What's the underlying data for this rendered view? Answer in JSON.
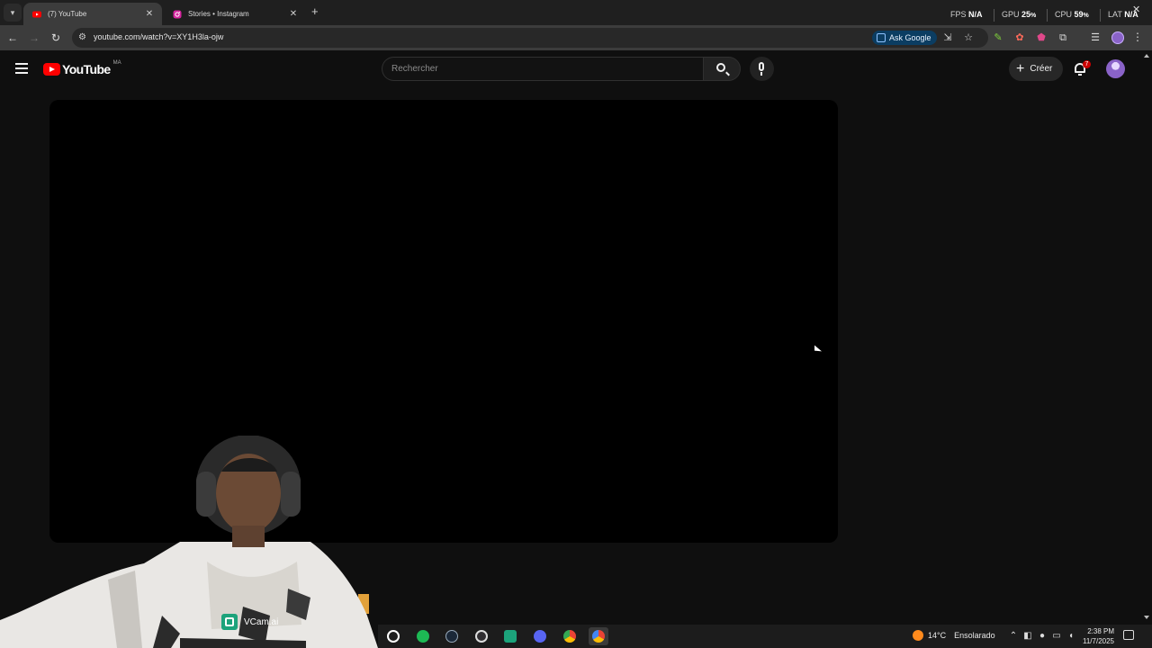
{
  "browser": {
    "tabs": [
      {
        "title": "(7) YouTube",
        "favicon": "youtube-icon",
        "active": true
      },
      {
        "title": "Stories • Instagram",
        "favicon": "instagram-icon",
        "active": false
      }
    ],
    "perf": {
      "fps_label": "FPS",
      "fps_value": "N/A",
      "gpu_label": "GPU",
      "gpu_value": "25",
      "cpu_label": "CPU",
      "cpu_value": "59",
      "lat_label": "LAT",
      "lat_value": "N/A"
    },
    "url": "youtube.com/watch?v=XY1H3la-ojw",
    "ask_google": "Ask Google",
    "icons": [
      "back-icon",
      "forward-icon",
      "reload-icon",
      "site-info-icon",
      "install-icon",
      "bookmark-star-icon",
      "extensions-icon",
      "tab-search-icon",
      "menu-kebab-icon"
    ]
  },
  "youtube": {
    "logo_text": "YouTube",
    "region": "MA",
    "search_placeholder": "Rechercher",
    "create_label": "Créer",
    "notification_count": "7"
  },
  "webcam": {
    "watermark": "VCam.ai"
  },
  "taskbar": {
    "apps": [
      "xbox-icon",
      "spotify-icon",
      "steam-icon",
      "obs-icon",
      "vcam-icon",
      "discord-icon",
      "chrome-icon",
      "chrome-canary-icon"
    ],
    "weather_temp": "14°C",
    "weather_text": "Ensolarado",
    "time": "2:38 PM",
    "date": "11/7/2025"
  },
  "colors": {
    "yt_red": "#ff0000",
    "background": "#0f0f0f",
    "ask_google_bg": "#0b3d62"
  }
}
